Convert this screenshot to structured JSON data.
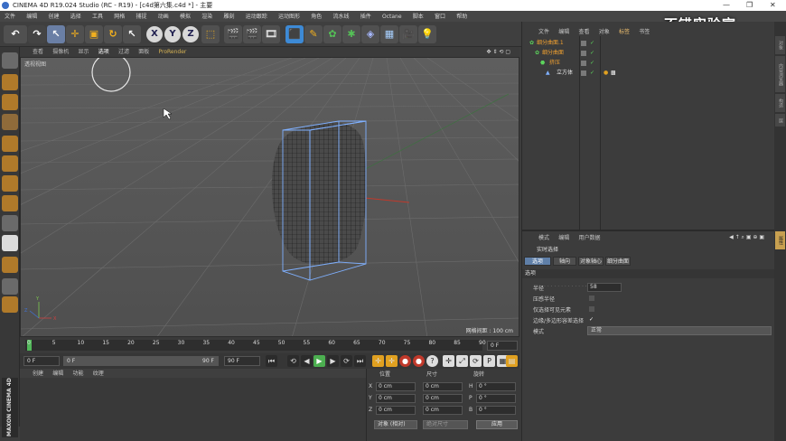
{
  "window": {
    "title": "CINEMA 4D R19.024 Studio (RC - R19) - [c4d第六集.c4d *] - 主要"
  },
  "menubar": [
    "文件",
    "编辑",
    "创建",
    "选择",
    "工具",
    "网格",
    "捕捉",
    "动画",
    "模拟",
    "渲染",
    "雕刻",
    "运动跟踪",
    "运动图形",
    "角色",
    "流水线",
    "插件",
    "Octane",
    "脚本",
    "窗口",
    "帮助"
  ],
  "watermark": "不错实验室 bilibili",
  "toolbar": {
    "axis_x": "X",
    "axis_y": "Y",
    "axis_z": "Z"
  },
  "viewport": {
    "menu": [
      "查看",
      "摄像机",
      "显示",
      "选项",
      "过滤",
      "面板",
      "ProRender"
    ],
    "active_menu": "选项",
    "label": "透视视图",
    "grid_info": "网格间距 : 100 cm",
    "colors": {
      "selection_box": "#7fb0ff",
      "object": "#2a2a2a"
    }
  },
  "timeline": {
    "ticks": [
      "0",
      "5",
      "10",
      "15",
      "20",
      "25",
      "30",
      "35",
      "40",
      "45",
      "50",
      "55",
      "60",
      "65",
      "70",
      "75",
      "80",
      "85",
      "90"
    ],
    "current_frame_field": "0 F"
  },
  "playback": {
    "start": "0 F",
    "range_start": "0 F",
    "range_end": "90 F",
    "end": "90 F"
  },
  "material_manager": {
    "menu": [
      "创建",
      "编辑",
      "功能",
      "纹理"
    ]
  },
  "coordinates": {
    "headers": {
      "position": "位置",
      "size": "尺寸",
      "rotation": "旋转"
    },
    "rows": [
      {
        "axis": "X",
        "pos": "0 cm",
        "size": "0 cm",
        "rot_axis": "H",
        "rot": "0 °"
      },
      {
        "axis": "Y",
        "pos": "0 cm",
        "size": "0 cm",
        "rot_axis": "P",
        "rot": "0 °"
      },
      {
        "axis": "Z",
        "pos": "0 cm",
        "size": "0 cm",
        "rot_axis": "B",
        "rot": "0 °"
      }
    ],
    "mode_select": "对象 (相对)",
    "size_select": "绝对尺寸",
    "apply": "应用"
  },
  "object_manager": {
    "tabs": [
      "文件",
      "编辑",
      "查看",
      "对象",
      "标签",
      "书签"
    ],
    "active_tab": "标签",
    "objects": [
      {
        "name": "细分曲面.1",
        "indent": 0
      },
      {
        "name": "细分曲面",
        "indent": 1
      },
      {
        "name": "挤压",
        "indent": 2
      },
      {
        "name": "立方体",
        "indent": 3
      }
    ]
  },
  "attribute_manager": {
    "menu": [
      "模式",
      "编辑",
      "用户数据"
    ],
    "title": "实时选择",
    "tabs": [
      "选项",
      "轴向",
      "对象轴心",
      "细分曲面"
    ],
    "active_tab": "选项",
    "section": "选项",
    "fields": [
      {
        "label": "半径",
        "value": "58"
      },
      {
        "label": "压感半径",
        "value": ""
      },
      {
        "label": "仅选择可见元素",
        "value": ""
      },
      {
        "label": "边缘/多边形容差选择",
        "value": "✓"
      },
      {
        "label": "模式",
        "value": "正常"
      }
    ]
  },
  "right_strip": [
    "对象",
    "内容浏览器",
    "构造",
    "层",
    "属性"
  ]
}
